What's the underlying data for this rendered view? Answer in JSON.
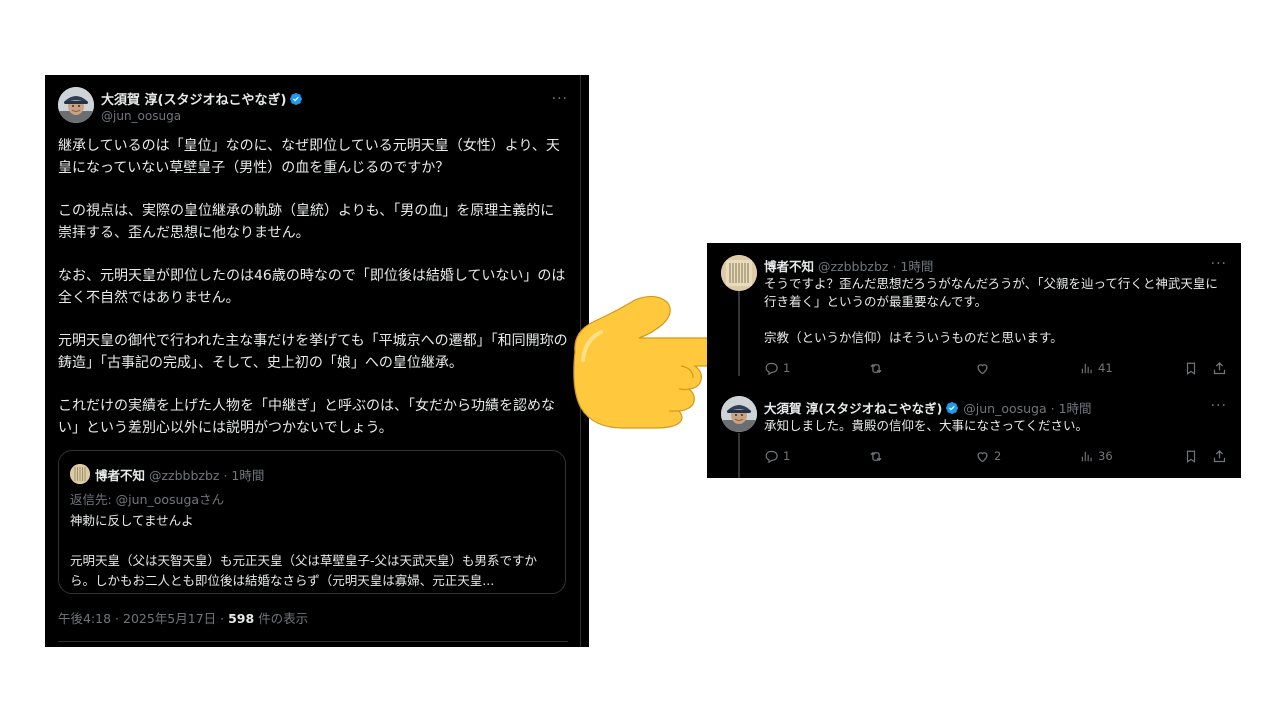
{
  "main_tweet": {
    "author": {
      "name": "大須賀 淳(スタジオねこやなぎ)",
      "handle": "@jun_oosuga",
      "verified_icon": "verified-badge-icon",
      "avatar_icon": "avatar-man-with-hat"
    },
    "more_label": "···",
    "paragraphs": [
      "継承しているのは「皇位」なのに、なぜ即位している元明天皇（女性）より、天皇になっていない草壁皇子（男性）の血を重んじるのですか？",
      "この視点は、実際の皇位継承の軌跡（皇統）よりも、「男の血」を原理主義的に崇拝する、歪んだ思想に他なりません。",
      "なお、元明天皇が即位したのは46歳の時なので「即位後は結婚していない」のは全く不自然ではありません。",
      "元明天皇の御代で行われた主な事だけを挙げても「平城京への遷都」「和同開珎の鋳造」「古事記の完成」、そして、史上初の「娘」への皇位継承。",
      "これだけの実績を上げた人物を「中継ぎ」と呼ぶのは、「女だから功績を認めない」という差別心以外には説明がつかないでしょう。"
    ],
    "quote": {
      "name": "博者不知",
      "meta": " @zzbbbzbz · 1時間",
      "reply_to": "返信先: @jun_oosugaさん",
      "line1": "神勅に反してませんよ",
      "line2": "元明天皇（父は天智天皇）も元正天皇（父は草壁皇子-父は天武天皇）も男系ですから。しかもお二人とも即位後は結婚なさらず（元明天皇は寡婦、元正天皇..."
    },
    "meta": {
      "time": "午後4:18 · 2025年5月17日 · ",
      "views": "598",
      "views_suffix": " 件の表示"
    }
  },
  "pointer_icon": "backhand-index-pointing-right-emoji",
  "thread": {
    "reply1": {
      "name": "博者不知",
      "meta": " @zzbbbzbz · 1時間",
      "more_label": "···",
      "text1": "そうですよ？歪んだ思想だろうがなんだろうが、「父親を辿って行くと神武天皇に行き着く」というのが最重要なんです。",
      "text2": "宗教（というか信仰）はそういうものだと思います。",
      "replies": "1",
      "retweets": "",
      "likes": "",
      "views": "41"
    },
    "reply2": {
      "name": "大須賀 淳(スタジオねこやなぎ)",
      "meta": " @jun_oosuga · 1時間",
      "more_label": "···",
      "text": "承知しました。貴殿の信仰を、大事になさってください。",
      "replies": "1",
      "retweets": "",
      "likes": "2",
      "views": "36"
    }
  },
  "colors": {
    "background": "#000000",
    "text": "#e7e9ea",
    "muted": "#71767b",
    "border": "#2f3336",
    "verified": "#1d9bf0",
    "hand": "#ffc83d"
  }
}
